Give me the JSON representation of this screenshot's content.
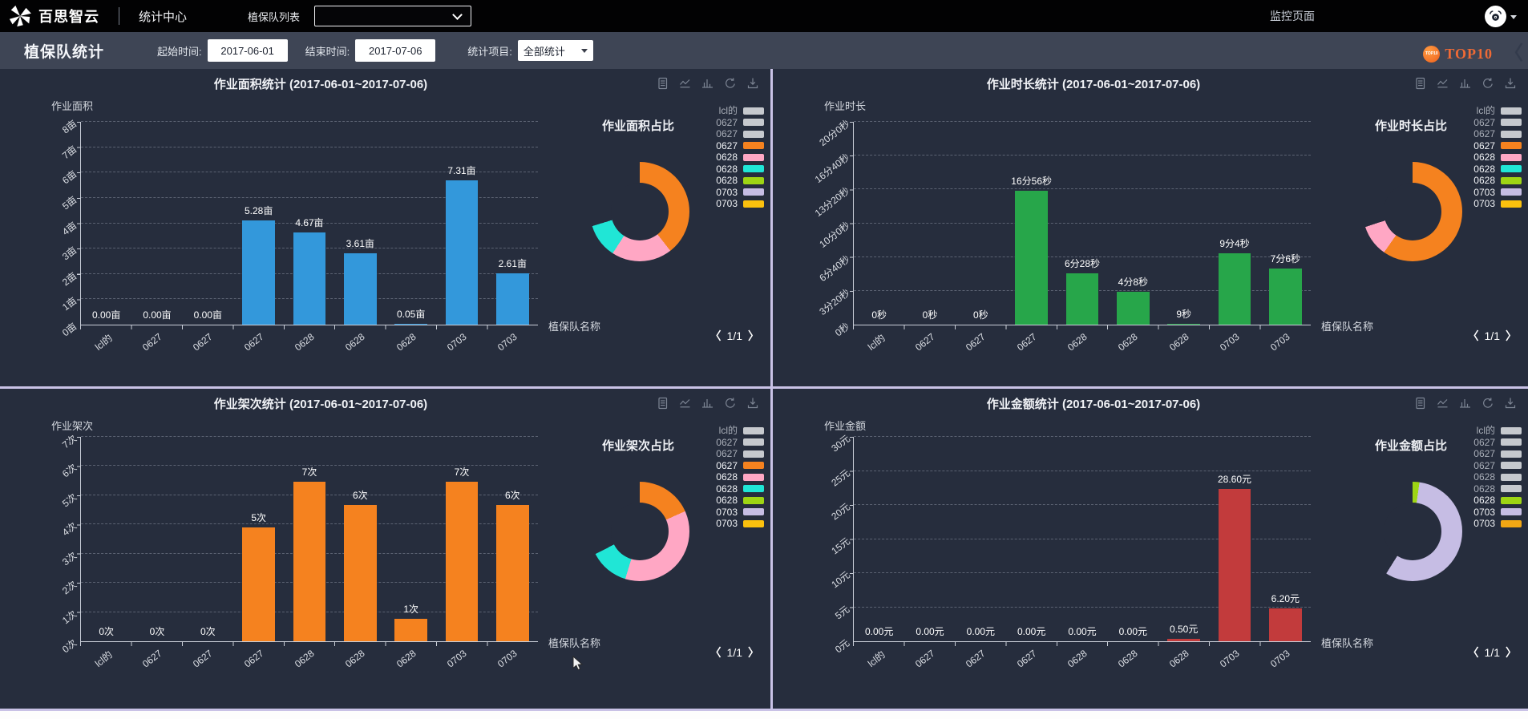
{
  "nav": {
    "brand": "百思智云",
    "menu_statistics": "统计中心",
    "team_list_label": "植保队列表",
    "team_select_value": "",
    "monitor_label": "监控页面"
  },
  "filter": {
    "page_title": "植保队统计",
    "start_label": "起始时间:",
    "start_value": "2017-06-01",
    "end_label": "结束时间:",
    "end_value": "2017-07-06",
    "item_label": "统计项目:",
    "item_value": "全部统计",
    "top10_badge": "TOP10",
    "top10_label": "TOP10",
    "collapse_icon": "〈"
  },
  "pager": {
    "prev": "〈",
    "label": "1/1",
    "next": "〉"
  },
  "colors": {
    "bar_blue": "#3398db",
    "bar_green": "#27a64a",
    "bar_orange": "#f5821f",
    "bar_red": "#c23b3c",
    "pie_orange": "#f5821f",
    "pie_pink": "#ffa7c4",
    "pie_cyan": "#20e6d6",
    "pie_green": "#9ed514",
    "pie_lavender": "#c6bde4",
    "pie_gold": "#fbc10e",
    "legend_disabled": "#c6c9ce",
    "divider": "#c9c2e6"
  },
  "chart_data": [
    {
      "type": "bar",
      "title": "作业面积统计 (2017-06-01~2017-07-06)",
      "y_axis_name": "作业面积",
      "x_axis_name": "植保队名称",
      "categories": [
        "lcl的",
        "0627",
        "0627",
        "0627",
        "0628",
        "0628",
        "0628",
        "0703",
        "0703"
      ],
      "values": [
        0,
        0,
        0,
        5.28,
        4.67,
        3.61,
        0.05,
        7.31,
        2.61
      ],
      "value_labels": [
        "0.00亩",
        "0.00亩",
        "0.00亩",
        "5.28亩",
        "4.67亩",
        "3.61亩",
        "0.05亩",
        "7.31亩",
        "2.61亩"
      ],
      "y_max": 8,
      "y_ticks": [
        "0亩",
        "1亩",
        "2亩",
        "3亩",
        "4亩",
        "5亩",
        "6亩",
        "7亩",
        "8亩"
      ],
      "bar_color": "#3398db",
      "pie": {
        "title": "作业面积占比",
        "segments": [
          {
            "color": "#f5821f",
            "from": 0,
            "to": 142
          },
          {
            "color": "#ffa7c4",
            "from": 142,
            "to": 213
          },
          {
            "color": "#20e6d6",
            "from": 213,
            "to": 253
          }
        ]
      },
      "legend": [
        {
          "label": "lcl的",
          "color": "#c6c9ce",
          "active": false
        },
        {
          "label": "0627",
          "color": "#c6c9ce",
          "active": false
        },
        {
          "label": "0627",
          "color": "#c6c9ce",
          "active": false
        },
        {
          "label": "0627",
          "color": "#f5821f",
          "active": true
        },
        {
          "label": "0628",
          "color": "#ffa7c4",
          "active": true
        },
        {
          "label": "0628",
          "color": "#20e6d6",
          "active": true
        },
        {
          "label": "0628",
          "color": "#9ed514",
          "active": true
        },
        {
          "label": "0703",
          "color": "#c6bde4",
          "active": true
        },
        {
          "label": "0703",
          "color": "#fbc10e",
          "active": true
        }
      ]
    },
    {
      "type": "bar",
      "title": "作业时长统计 (2017-06-01~2017-07-06)",
      "y_axis_name": "作业时长",
      "x_axis_name": "植保队名称",
      "categories": [
        "lcl的",
        "0627",
        "0627",
        "0627",
        "0628",
        "0628",
        "0628",
        "0703",
        "0703"
      ],
      "values": [
        0,
        0,
        0,
        1016,
        388,
        248,
        9,
        544,
        426
      ],
      "value_labels": [
        "0秒",
        "0秒",
        "0秒",
        "16分56秒",
        "6分28秒",
        "4分8秒",
        "9秒",
        "9分4秒",
        "7分6秒"
      ],
      "y_max": 1200,
      "y_ticks": [
        "0秒",
        "3分20秒",
        "6分40秒",
        "10分0秒",
        "13分20秒",
        "16分40秒",
        "20分0秒"
      ],
      "bar_color": "#27a64a",
      "pie": {
        "title": "作业时长占比",
        "segments": [
          {
            "color": "#f5821f",
            "from": 0,
            "to": 215
          },
          {
            "color": "#ffa7c4",
            "from": 215,
            "to": 252
          }
        ]
      },
      "legend": [
        {
          "label": "lcl的",
          "color": "#c6c9ce",
          "active": false
        },
        {
          "label": "0627",
          "color": "#c6c9ce",
          "active": false
        },
        {
          "label": "0627",
          "color": "#c6c9ce",
          "active": false
        },
        {
          "label": "0627",
          "color": "#f5821f",
          "active": true
        },
        {
          "label": "0628",
          "color": "#ffa7c4",
          "active": true
        },
        {
          "label": "0628",
          "color": "#20e6d6",
          "active": true
        },
        {
          "label": "0628",
          "color": "#9ed514",
          "active": true
        },
        {
          "label": "0703",
          "color": "#c6bde4",
          "active": true
        },
        {
          "label": "0703",
          "color": "#fbc10e",
          "active": true
        }
      ]
    },
    {
      "type": "bar",
      "title": "作业架次统计 (2017-06-01~2017-07-06)",
      "y_axis_name": "作业架次",
      "x_axis_name": "植保队名称",
      "categories": [
        "lcl的",
        "0627",
        "0627",
        "0627",
        "0628",
        "0628",
        "0628",
        "0703",
        "0703"
      ],
      "values": [
        0,
        0,
        0,
        5,
        7,
        6,
        1,
        7,
        6
      ],
      "value_labels": [
        "0次",
        "0次",
        "0次",
        "5次",
        "7次",
        "6次",
        "1次",
        "7次",
        "6次"
      ],
      "y_max": 7,
      "y_ticks": [
        "0次",
        "1次",
        "2次",
        "3次",
        "4次",
        "5次",
        "6次",
        "7次"
      ],
      "bar_color": "#f5821f",
      "pie": {
        "title": "作业架次占比",
        "segments": [
          {
            "color": "#f5821f",
            "from": 0,
            "to": 66
          },
          {
            "color": "#ffa7c4",
            "from": 66,
            "to": 197
          },
          {
            "color": "#20e6d6",
            "from": 197,
            "to": 243
          }
        ]
      },
      "legend": [
        {
          "label": "lcl的",
          "color": "#c6c9ce",
          "active": false
        },
        {
          "label": "0627",
          "color": "#c6c9ce",
          "active": false
        },
        {
          "label": "0627",
          "color": "#c6c9ce",
          "active": false
        },
        {
          "label": "0627",
          "color": "#f5821f",
          "active": true
        },
        {
          "label": "0628",
          "color": "#ffa7c4",
          "active": true
        },
        {
          "label": "0628",
          "color": "#20e6d6",
          "active": true
        },
        {
          "label": "0628",
          "color": "#9ed514",
          "active": true
        },
        {
          "label": "0703",
          "color": "#c6bde4",
          "active": true
        },
        {
          "label": "0703",
          "color": "#fbc10e",
          "active": true
        }
      ]
    },
    {
      "type": "bar",
      "title": "作业金额统计 (2017-06-01~2017-07-06)",
      "y_axis_name": "作业金额",
      "x_axis_name": "植保队名称",
      "categories": [
        "lcl的",
        "0627",
        "0627",
        "0627",
        "0628",
        "0628",
        "0628",
        "0703",
        "0703"
      ],
      "values": [
        0,
        0,
        0,
        0,
        0,
        0,
        0.5,
        28.6,
        6.2
      ],
      "value_labels": [
        "0.00元",
        "0.00元",
        "0.00元",
        "0.00元",
        "0.00元",
        "0.00元",
        "0.50元",
        "28.60元",
        "6.20元"
      ],
      "y_max": 30,
      "y_ticks": [
        "0元",
        "5元",
        "10元",
        "15元",
        "20元",
        "25元",
        "30元"
      ],
      "bar_color": "#c23b3c",
      "pie": {
        "title": "作业金额占比",
        "segments": [
          {
            "color": "#9ed514",
            "from": 0,
            "to": 8
          },
          {
            "color": "#c6bde4",
            "from": 8,
            "to": 212
          }
        ]
      },
      "legend": [
        {
          "label": "lcl的",
          "color": "#c6c9ce",
          "active": false
        },
        {
          "label": "0627",
          "color": "#c6c9ce",
          "active": false
        },
        {
          "label": "0627",
          "color": "#c6c9ce",
          "active": false
        },
        {
          "label": "0627",
          "color": "#c6c9ce",
          "active": false
        },
        {
          "label": "0628",
          "color": "#c6c9ce",
          "active": false
        },
        {
          "label": "0628",
          "color": "#c6c9ce",
          "active": false
        },
        {
          "label": "0628",
          "color": "#9ed514",
          "active": true
        },
        {
          "label": "0703",
          "color": "#c6bde4",
          "active": true
        },
        {
          "label": "0703",
          "color": "#f2a714",
          "active": true
        }
      ]
    }
  ]
}
